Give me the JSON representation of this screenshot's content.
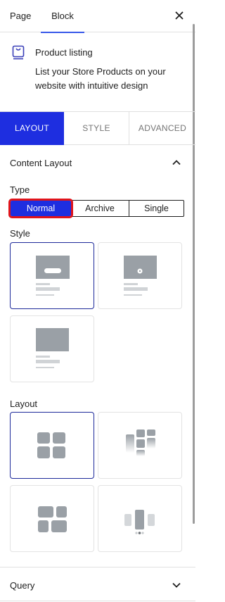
{
  "header": {
    "tabs": [
      {
        "label": "Page"
      },
      {
        "label": "Block"
      }
    ],
    "close_icon": "close-icon"
  },
  "block": {
    "icon": "product-listing-icon",
    "title": "Product listing",
    "description": "List your Store Products on your website with intuitive design"
  },
  "settings_tabs": [
    {
      "label": "LAYOUT",
      "active": true
    },
    {
      "label": "STYLE",
      "active": false
    },
    {
      "label": "ADVANCED",
      "active": false
    }
  ],
  "content_layout": {
    "title": "Content Layout",
    "expanded": true,
    "type": {
      "label": "Type",
      "options": [
        "Normal",
        "Archive",
        "Single"
      ],
      "selected": "Normal"
    },
    "style": {
      "label": "Style",
      "options": [
        "style-1",
        "style-2",
        "style-3"
      ],
      "selected": "style-1"
    },
    "layout": {
      "label": "Layout",
      "options": [
        "grid-2x2",
        "masonry",
        "grid-mixed",
        "carousel"
      ],
      "selected": "grid-2x2"
    }
  },
  "query": {
    "title": "Query",
    "expanded": false
  },
  "colors": {
    "accent": "#1e2ee0",
    "highlight_outline": "#e0141b",
    "selected_border": "#1e2a9a",
    "placeholder_gray": "#9aa0a6"
  }
}
